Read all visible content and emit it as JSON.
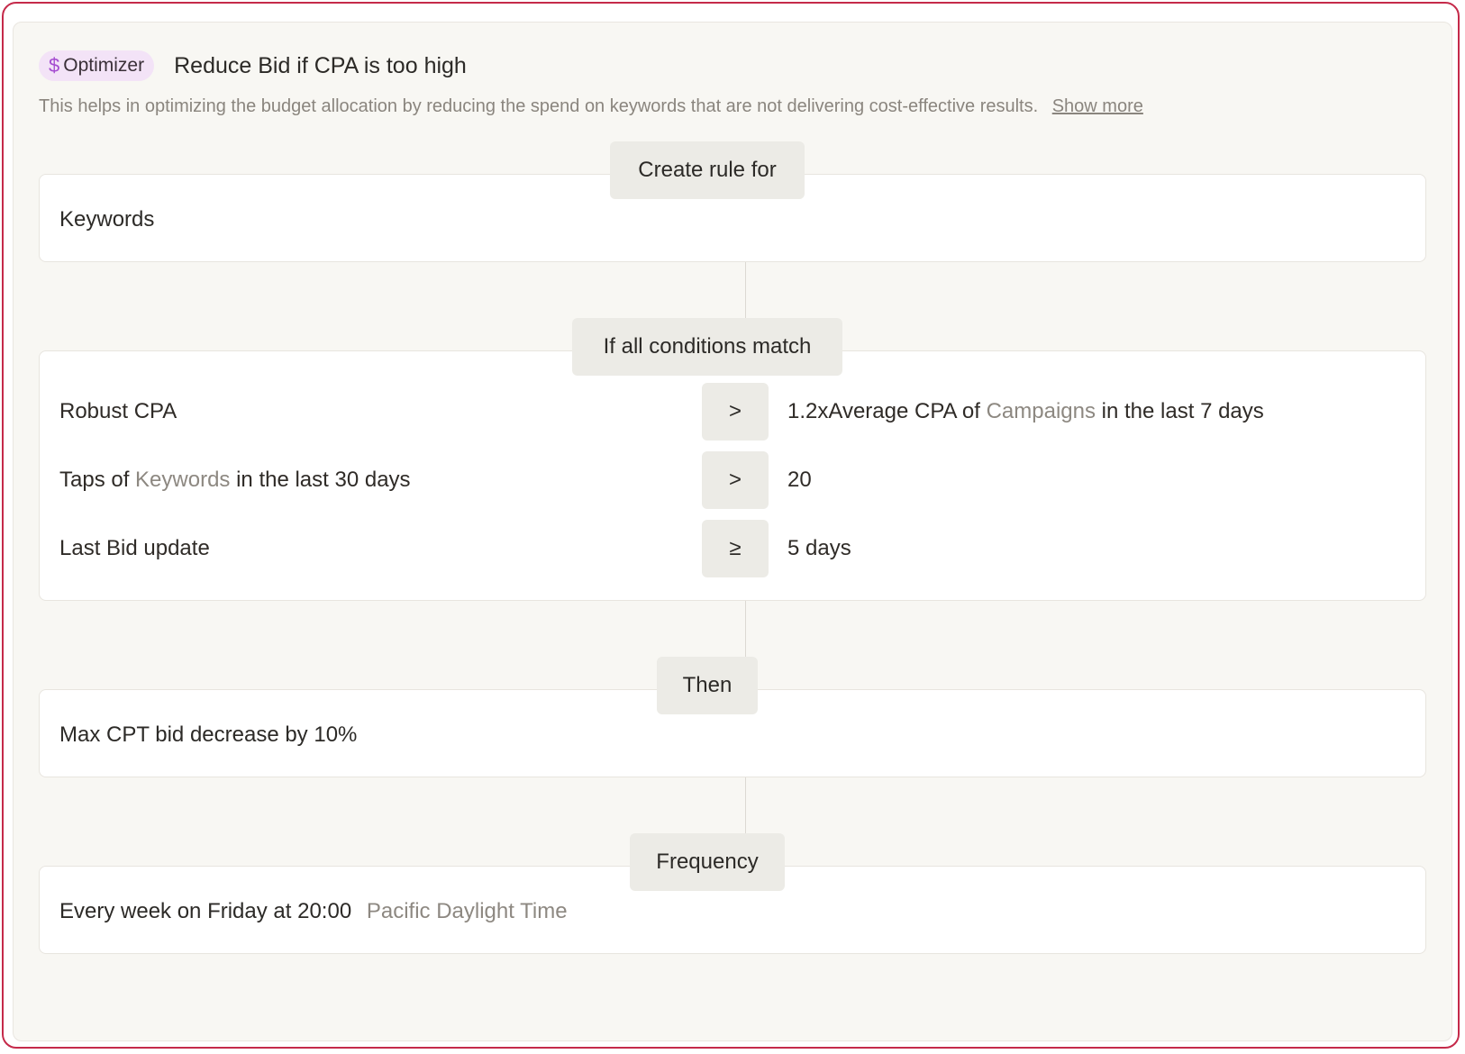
{
  "header": {
    "badge_icon": "dollar-icon",
    "badge_symbol": "$",
    "badge_label": "Optimizer",
    "title": "Reduce Bid if CPA is too high",
    "description": "This helps in optimizing the budget allocation by reducing the spend on keywords that are not delivering cost-effective results.",
    "show_more": "Show more"
  },
  "create_rule": {
    "tag": "Create rule for",
    "value": "Keywords"
  },
  "conditions": {
    "tag": "If all conditions match",
    "rows": [
      {
        "left_pre": "Robust CPA",
        "left_link": "",
        "left_post": "",
        "operator": ">",
        "right_pre": "1.2xAverage CPA of ",
        "right_link": "Campaigns",
        "right_post": " in the last 7 days"
      },
      {
        "left_pre": "Taps of ",
        "left_link": "Keywords",
        "left_post": " in the last 30 days",
        "operator": ">",
        "right_pre": "20",
        "right_link": "",
        "right_post": ""
      },
      {
        "left_pre": "Last Bid update",
        "left_link": "",
        "left_post": "",
        "operator": "≥",
        "right_pre": "5 days",
        "right_link": "",
        "right_post": ""
      }
    ]
  },
  "then": {
    "tag": "Then",
    "value": "Max CPT bid decrease by 10%"
  },
  "frequency": {
    "tag": "Frequency",
    "value": "Every week on Friday at 20:00",
    "timezone": "Pacific Daylight Time"
  },
  "colors": {
    "border_accent": "#c52a4a",
    "badge_bg": "#f3e3f7",
    "badge_icon": "#a44bd0",
    "muted_text": "#8d8881"
  }
}
